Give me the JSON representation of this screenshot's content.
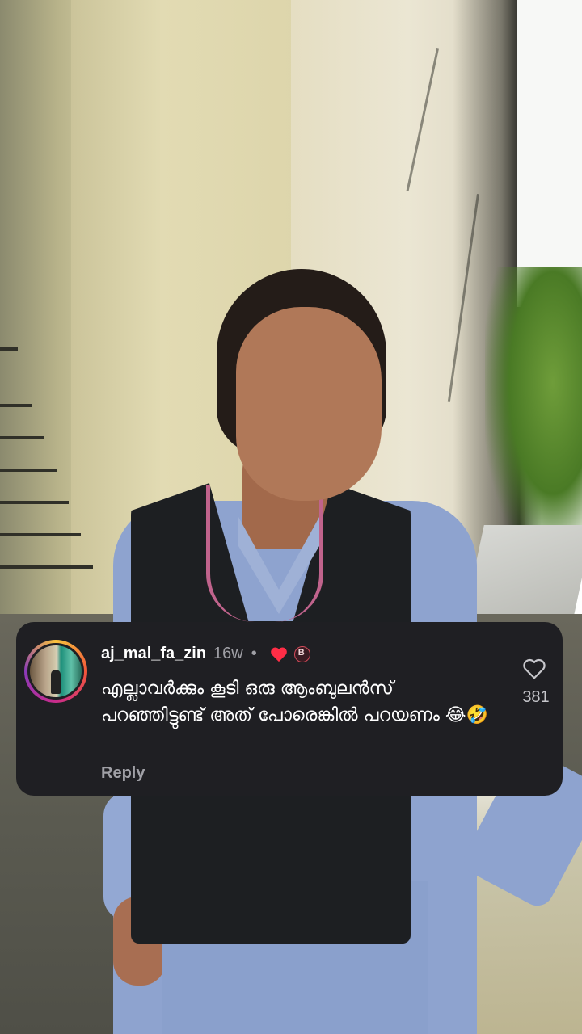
{
  "comment": {
    "username": "aj_mal_fa_zin",
    "age": "16w",
    "separator": "•",
    "creator_badge": "B",
    "text": "എല്ലാവർക്കും കൂടി ഒരു ആംബുലൻസ് പറഞ്ഞിട്ടുണ്ട് അത് പോരെങ്കിൽ പറയണം 😂🤣",
    "reply_label": "Reply",
    "like_count": "381",
    "liked_by_creator": true,
    "avatar_ring": "story-gradient"
  },
  "colors": {
    "card_bg": "#1f1f23",
    "secondary_text": "#a0a0a6",
    "heart_red": "#ff2d46"
  },
  "icons": {
    "like": "heart-outline-icon",
    "creator_like": "heart-filled-icon"
  }
}
